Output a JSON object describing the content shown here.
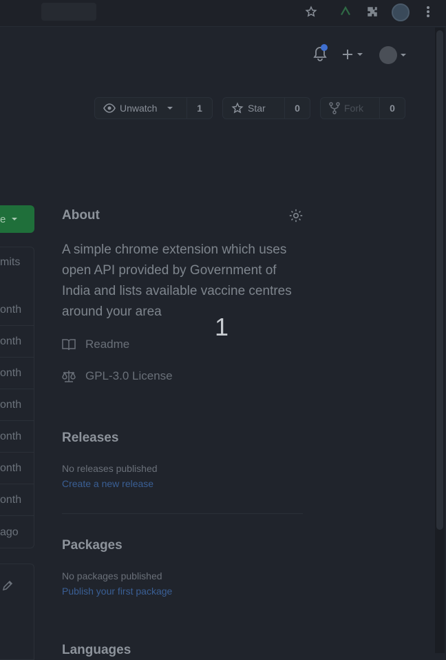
{
  "browser": {
    "icons": [
      "bookmark-star-icon",
      "extension-icon",
      "puzzle-icon",
      "profile-icon",
      "kebab-menu-icon"
    ]
  },
  "header": {
    "icons": [
      "bell-icon",
      "plus-icon",
      "avatar"
    ]
  },
  "repo_actions": {
    "watch_label": "Unwatch",
    "watch_count": "1",
    "star_label": "Star",
    "star_count": "0",
    "fork_label": "Fork",
    "fork_count": "0"
  },
  "left_panel": {
    "code_button_fragment": "e",
    "commits_fragment": "mits",
    "rows": [
      "onth",
      "onth",
      "onth",
      "onth",
      "onth",
      "onth",
      "onth",
      "ago"
    ]
  },
  "about": {
    "title": "About",
    "description": "A simple chrome extension which uses open API provided by Government of India and lists available vaccine centres around your area",
    "readme_label": "Readme",
    "license_label": "GPL-3.0 License"
  },
  "releases": {
    "title": "Releases",
    "empty_text": "No releases published",
    "link_text": "Create a new release"
  },
  "packages": {
    "title": "Packages",
    "empty_text": "No packages published",
    "link_text": "Publish your first package"
  },
  "languages": {
    "title": "Languages"
  },
  "overlay": {
    "marker": "1"
  },
  "colors": {
    "background": "#20242c",
    "accent_green": "#1f6f3a",
    "link_blue": "#3a5f95",
    "notification_dot": "#3f6fd0"
  }
}
